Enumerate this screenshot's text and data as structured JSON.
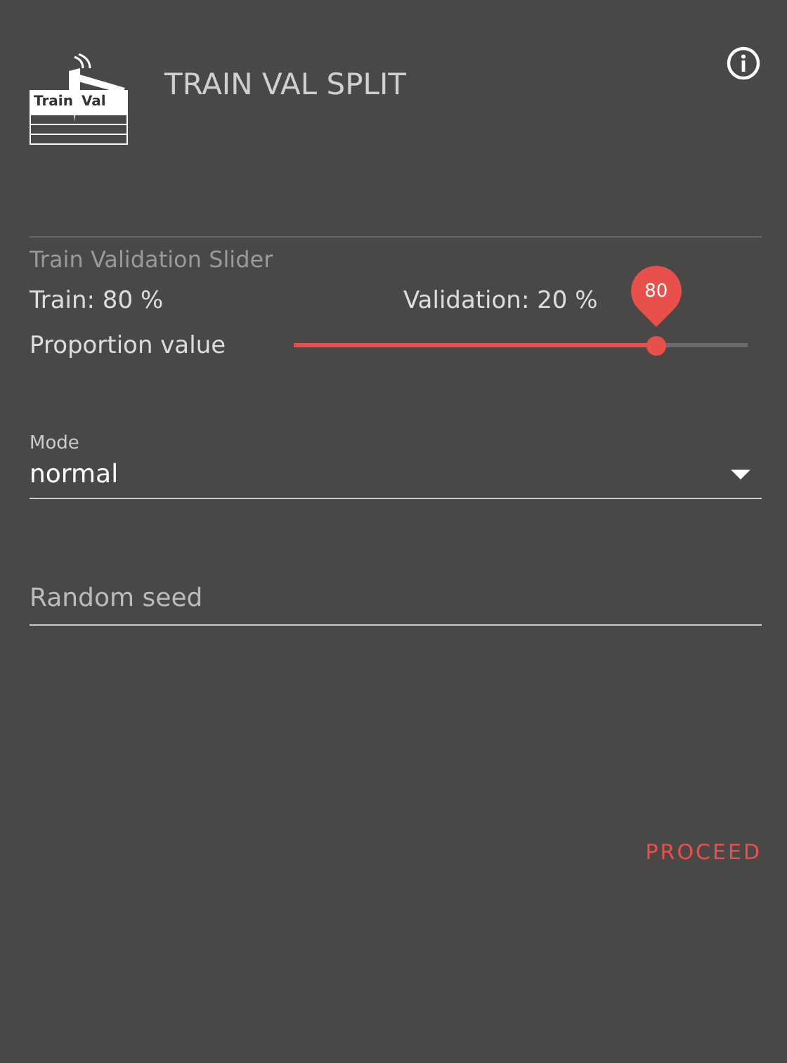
{
  "header": {
    "logo_texts": [
      "Train",
      "Val"
    ],
    "title": "TRAIN VAL SPLIT"
  },
  "slider_section": {
    "title": "Train Validation Slider",
    "train_label": "Train: 80 %",
    "validation_label": "Validation: 20 %",
    "slider_label": "Proportion value",
    "level": 0.8,
    "bubble": "80"
  },
  "mode": {
    "label": "Mode",
    "value": "normal"
  },
  "seed": {
    "placeholder": "Random seed"
  },
  "buttons": [
    "PROCEED"
  ]
}
